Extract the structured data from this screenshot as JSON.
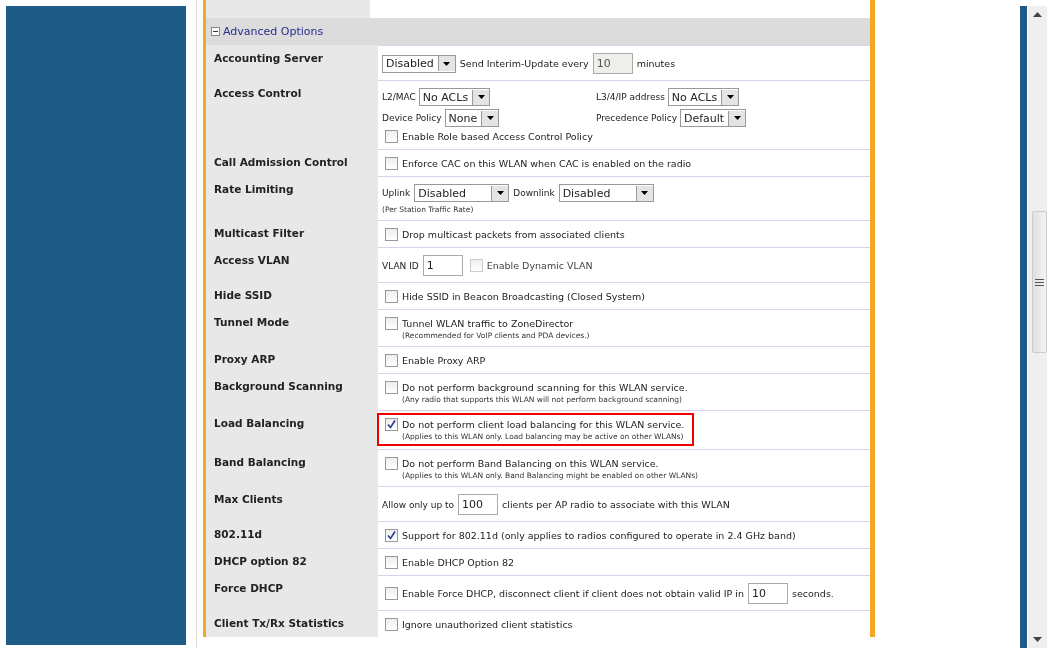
{
  "section": {
    "title": "Advanced Options",
    "expanded": true
  },
  "rows": [
    {
      "label": "Accounting Server",
      "highlighted": false,
      "lines": [
        {
          "kind": "flow",
          "items": [
            {
              "kind": "select",
              "value": "Disabled"
            },
            {
              "kind": "text",
              "text": "Send Interim-Update every"
            },
            {
              "kind": "input",
              "value": "10",
              "disabled": true
            },
            {
              "kind": "text",
              "text": "minutes"
            }
          ]
        }
      ]
    },
    {
      "label": "Access Control",
      "highlighted": false,
      "lines": [
        {
          "kind": "pair",
          "items": [
            {
              "kind": "labeled_select",
              "label": "L2/MAC",
              "value": "No ACLs"
            },
            {
              "kind": "labeled_select",
              "label": "L3/4/IP address",
              "value": "No ACLs"
            }
          ]
        },
        {
          "kind": "pair",
          "items": [
            {
              "kind": "labeled_select",
              "label": "Device Policy",
              "value": "None"
            },
            {
              "kind": "labeled_select",
              "label": "Precedence Policy",
              "value": "Default"
            }
          ]
        },
        {
          "kind": "flow",
          "items": [
            {
              "kind": "checkbox",
              "label": "Enable Role based Access Control Policy",
              "checked": false,
              "disabled": false
            }
          ]
        }
      ]
    },
    {
      "label": "Call Admission Control",
      "highlighted": false,
      "lines": [
        {
          "kind": "flow",
          "items": [
            {
              "kind": "checkbox",
              "label": "Enforce CAC on this WLAN when CAC is enabled on the radio",
              "checked": false,
              "disabled": false
            }
          ]
        }
      ]
    },
    {
      "label": "Rate Limiting",
      "highlighted": false,
      "lines": [
        {
          "kind": "flow",
          "items": [
            {
              "kind": "small_text",
              "text": "Uplink"
            },
            {
              "kind": "select",
              "value": "Disabled"
            },
            {
              "kind": "small_text",
              "text": "Downlink"
            },
            {
              "kind": "select",
              "value": "Disabled"
            }
          ]
        },
        {
          "kind": "flow",
          "items": [
            {
              "kind": "note",
              "text": "(Per Station Traffic Rate)"
            }
          ]
        }
      ]
    },
    {
      "label": "Multicast Filter",
      "highlighted": false,
      "lines": [
        {
          "kind": "flow",
          "items": [
            {
              "kind": "checkbox",
              "label": "Drop multicast packets from associated clients",
              "checked": false,
              "disabled": false
            }
          ]
        }
      ]
    },
    {
      "label": "Access VLAN",
      "highlighted": false,
      "lines": [
        {
          "kind": "flow",
          "items": [
            {
              "kind": "small_text",
              "text": "VLAN ID"
            },
            {
              "kind": "input",
              "value": "1",
              "disabled": false
            },
            {
              "kind": "checkbox",
              "label": "Enable Dynamic VLAN",
              "checked": false,
              "disabled": true
            }
          ]
        }
      ]
    },
    {
      "label": "Hide SSID",
      "highlighted": false,
      "lines": [
        {
          "kind": "flow",
          "items": [
            {
              "kind": "checkbox",
              "label": "Hide SSID in Beacon Broadcasting (Closed System)",
              "checked": false,
              "disabled": false
            }
          ]
        }
      ]
    },
    {
      "label": "Tunnel Mode",
      "highlighted": false,
      "lines": [
        {
          "kind": "flow",
          "items": [
            {
              "kind": "checkbox",
              "label": "Tunnel WLAN traffic to ZoneDirector",
              "checked": false,
              "disabled": false,
              "note": "(Recommended for VoIP clients and PDA devices.)"
            }
          ]
        }
      ]
    },
    {
      "label": "Proxy ARP",
      "highlighted": false,
      "lines": [
        {
          "kind": "flow",
          "items": [
            {
              "kind": "checkbox",
              "label": "Enable Proxy ARP",
              "checked": false,
              "disabled": false
            }
          ]
        }
      ]
    },
    {
      "label": "Background Scanning",
      "highlighted": false,
      "lines": [
        {
          "kind": "flow",
          "items": [
            {
              "kind": "checkbox",
              "label": "Do not perform background scanning for this WLAN service.",
              "checked": false,
              "disabled": false,
              "note": "(Any radio that supports this WLAN will not perform background scanning)"
            }
          ]
        }
      ]
    },
    {
      "label": "Load Balancing",
      "highlighted": true,
      "lines": [
        {
          "kind": "flow",
          "items": [
            {
              "kind": "checkbox",
              "label": "Do not perform client load balancing for this WLAN service.",
              "checked": true,
              "disabled": false,
              "note": "(Applies to this WLAN only. Load balancing may be active on other WLANs)"
            }
          ]
        }
      ]
    },
    {
      "label": "Band Balancing",
      "highlighted": false,
      "lines": [
        {
          "kind": "flow",
          "items": [
            {
              "kind": "checkbox",
              "label": "Do not perform Band Balancing on this WLAN service.",
              "checked": false,
              "disabled": false,
              "note": "(Applies to this WLAN only. Band Balancing might be enabled on other WLANs)"
            }
          ]
        }
      ]
    },
    {
      "label": "Max Clients",
      "highlighted": false,
      "lines": [
        {
          "kind": "flow",
          "items": [
            {
              "kind": "small_text",
              "text": "Allow only up to"
            },
            {
              "kind": "input",
              "value": "100",
              "disabled": false
            },
            {
              "kind": "text",
              "text": "clients per AP radio to associate with this WLAN"
            }
          ]
        }
      ]
    },
    {
      "label": "802.11d",
      "highlighted": false,
      "lines": [
        {
          "kind": "flow",
          "items": [
            {
              "kind": "checkbox",
              "label": "Support for 802.11d (only applies to radios configured to operate in 2.4 GHz band)",
              "checked": true,
              "disabled": false
            }
          ]
        }
      ]
    },
    {
      "label": "DHCP option 82",
      "highlighted": false,
      "lines": [
        {
          "kind": "flow",
          "items": [
            {
              "kind": "checkbox",
              "label": "Enable DHCP Option 82",
              "checked": false,
              "disabled": false
            }
          ]
        }
      ]
    },
    {
      "label": "Force DHCP",
      "highlighted": false,
      "lines": [
        {
          "kind": "flow",
          "items": [
            {
              "kind": "checkbox",
              "label": "Enable Force DHCP, disconnect client if client does not obtain valid IP in",
              "checked": false,
              "disabled": false
            },
            {
              "kind": "input",
              "value": "10",
              "disabled": false
            },
            {
              "kind": "text",
              "text": "seconds."
            }
          ]
        }
      ]
    },
    {
      "label": "Client Tx/Rx Statistics",
      "highlighted": false,
      "lines": [
        {
          "kind": "flow",
          "items": [
            {
              "kind": "checkbox",
              "label": "Ignore unauthorized client statistics",
              "checked": false,
              "disabled": false
            }
          ]
        }
      ]
    }
  ]
}
